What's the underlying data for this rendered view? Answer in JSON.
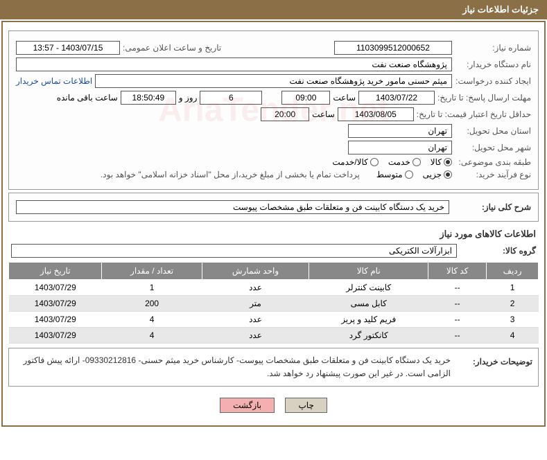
{
  "title": "جزئیات اطلاعات نیاز",
  "fields": {
    "need_number_label": "شماره نیاز:",
    "need_number": "1103099512000652",
    "announce_label": "تاریخ و ساعت اعلان عمومی:",
    "announce_value": "1403/07/15 - 13:57",
    "buyer_org_label": "نام دستگاه خریدار:",
    "buyer_org": "پژوهشگاه صنعت نفت",
    "requester_label": "ایجاد کننده درخواست:",
    "requester": "میثم حسنی مامور خرید پژوهشگاه صنعت نفت",
    "contact_link": "اطلاعات تماس خریدار",
    "deadline_label": "مهلت ارسال پاسخ: تا تاریخ:",
    "deadline_date": "1403/07/22",
    "time_label": "ساعت",
    "deadline_time": "09:00",
    "days_label": "روز و",
    "days_value": "6",
    "countdown": "18:50:49",
    "remaining_label": "ساعت باقی مانده",
    "validity_label": "حداقل تاریخ اعتبار قیمت: تا تاریخ:",
    "validity_date": "1403/08/05",
    "validity_time": "20:00",
    "province_label": "استان محل تحویل:",
    "province": "تهران",
    "city_label": "شهر محل تحویل:",
    "city": "تهران",
    "category_label": "طبقه بندی موضوعی:",
    "cat_goods": "کالا",
    "cat_service": "خدمت",
    "cat_goods_service": "کالا/خدمت",
    "process_label": "نوع فرآیند خرید:",
    "proc_partial": "جزیی",
    "proc_medium": "متوسط",
    "payment_note": "پرداخت تمام یا بخشی از مبلغ خرید،از محل \"اسناد خزانه اسلامی\" خواهد بود.",
    "summary_label": "شرح کلی نیاز:",
    "summary": "خرید یک دستگاه کابینت فن و متعلقات طبق مشخصات پیوست",
    "items_title": "اطلاعات کالاهای مورد نیاز",
    "group_label": "گروه کالا:",
    "group": "ابزارآلات الکتریکی",
    "buyer_notes_label": "توضیحات خریدار:",
    "buyer_notes": "خرید یک دستگاه کابینت فن و متعلقات طبق مشخصات پیوست- کارشناس خرید میثم حسنی- 09330212816- ارائه پیش فاکتور الزامی است. در غیر این صورت پیشنهاد رد خواهد شد."
  },
  "table": {
    "headers": [
      "ردیف",
      "کد کالا",
      "نام کالا",
      "واحد شمارش",
      "تعداد / مقدار",
      "تاریخ نیاز"
    ],
    "rows": [
      [
        "1",
        "--",
        "کابینت کنترلر",
        "عدد",
        "1",
        "1403/07/29"
      ],
      [
        "2",
        "--",
        "کابل مسی",
        "متر",
        "200",
        "1403/07/29"
      ],
      [
        "3",
        "--",
        "فریم کلید و پریز",
        "عدد",
        "4",
        "1403/07/29"
      ],
      [
        "4",
        "--",
        "کانکتور گرد",
        "عدد",
        "4",
        "1403/07/29"
      ]
    ]
  },
  "buttons": {
    "print": "چاپ",
    "back": "بازگشت"
  },
  "watermark": "AriaTender.net",
  "chart_data": {
    "type": "table",
    "title": "اطلاعات کالاهای مورد نیاز",
    "columns": [
      "ردیف",
      "کد کالا",
      "نام کالا",
      "واحد شمارش",
      "تعداد / مقدار",
      "تاریخ نیاز"
    ],
    "rows": [
      {
        "row": 1,
        "code": "--",
        "name": "کابینت کنترلر",
        "unit": "عدد",
        "qty": 1,
        "date": "1403/07/29"
      },
      {
        "row": 2,
        "code": "--",
        "name": "کابل مسی",
        "unit": "متر",
        "qty": 200,
        "date": "1403/07/29"
      },
      {
        "row": 3,
        "code": "--",
        "name": "فریم کلید و پریز",
        "unit": "عدد",
        "qty": 4,
        "date": "1403/07/29"
      },
      {
        "row": 4,
        "code": "--",
        "name": "کانکتور گرد",
        "unit": "عدد",
        "qty": 4,
        "date": "1403/07/29"
      }
    ]
  }
}
